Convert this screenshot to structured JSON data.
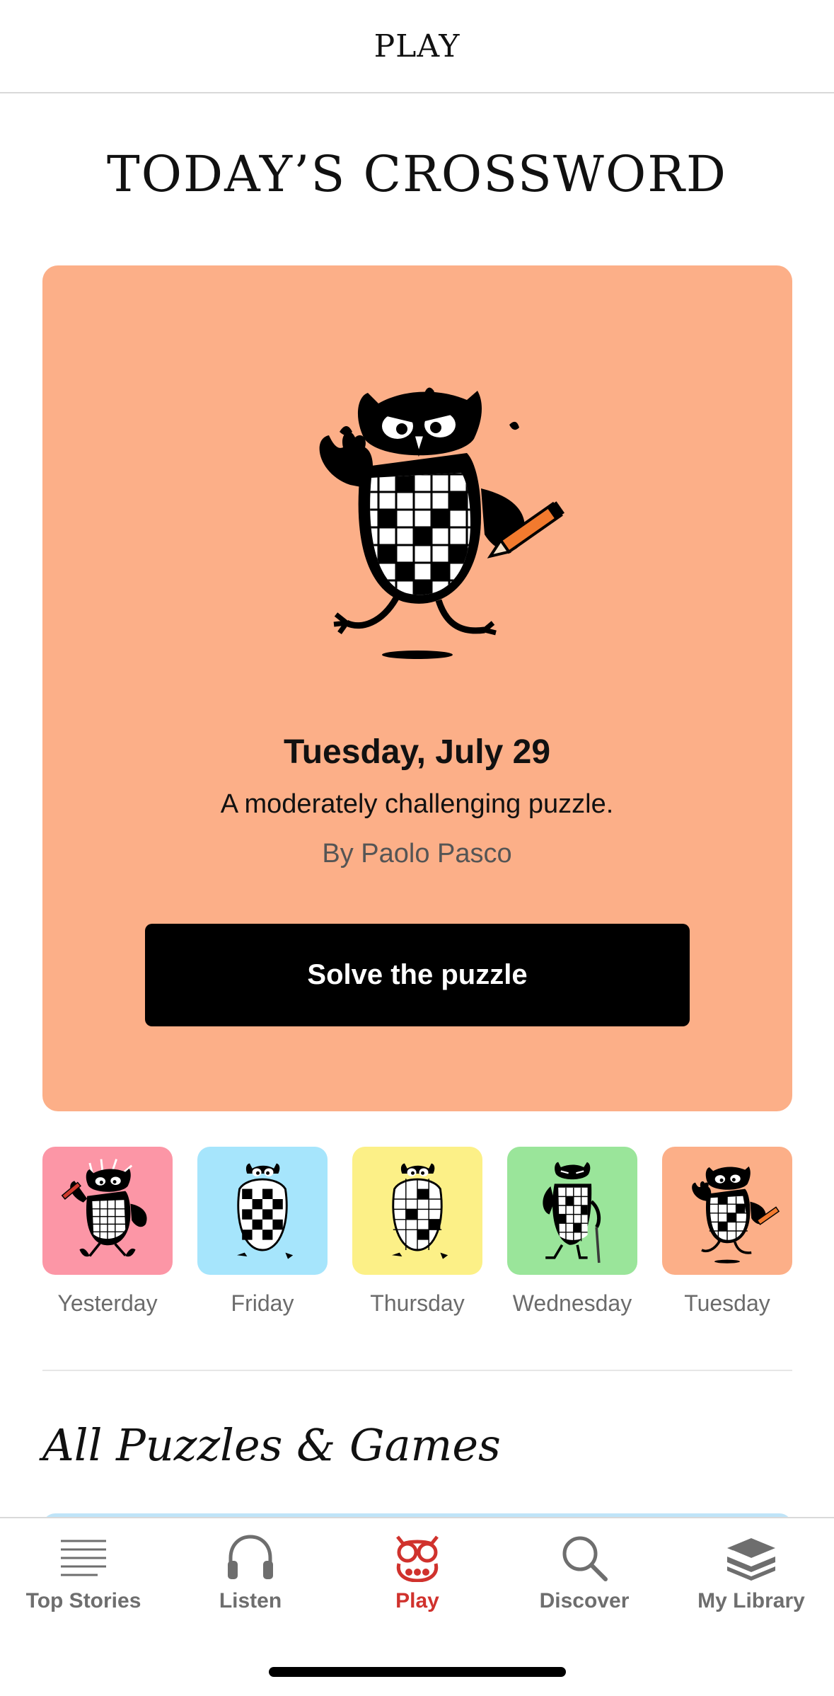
{
  "header": {
    "title": "PLAY"
  },
  "crossword": {
    "section_title": "TODAY’S CROSSWORD",
    "hero": {
      "date": "Tuesday, July 29",
      "description": "A moderately challenging puzzle.",
      "byline": "By Paolo Pasco",
      "button_label": "Solve the puzzle",
      "background_color": "#FCAF88",
      "illustration": "owl-crossword-running-with-pencil"
    },
    "archive": [
      {
        "label": "Yesterday",
        "color": "#FC96A6",
        "illustration": "owl-crossword-angry-pencil"
      },
      {
        "label": "Friday",
        "color": "#A6E5FC",
        "illustration": "owl-crossword-egg"
      },
      {
        "label": "Thursday",
        "color": "#FCF087",
        "illustration": "owl-crossword-egg"
      },
      {
        "label": "Wednesday",
        "color": "#9AE59A",
        "illustration": "owl-crossword-cane"
      },
      {
        "label": "Tuesday",
        "color": "#FCAF88",
        "illustration": "owl-crossword-running-with-pencil"
      }
    ]
  },
  "games": {
    "title": "All Puzzles & Games"
  },
  "tabbar": {
    "items": [
      {
        "label": "Top Stories",
        "icon": "lines-icon",
        "active": false
      },
      {
        "label": "Listen",
        "icon": "headphones-icon",
        "active": false
      },
      {
        "label": "Play",
        "icon": "owl-icon",
        "active": true
      },
      {
        "label": "Discover",
        "icon": "search-icon",
        "active": false
      },
      {
        "label": "My Library",
        "icon": "library-stack-icon",
        "active": false
      }
    ],
    "active_color": "#D0322D",
    "inactive_color": "#6E6E6E"
  }
}
